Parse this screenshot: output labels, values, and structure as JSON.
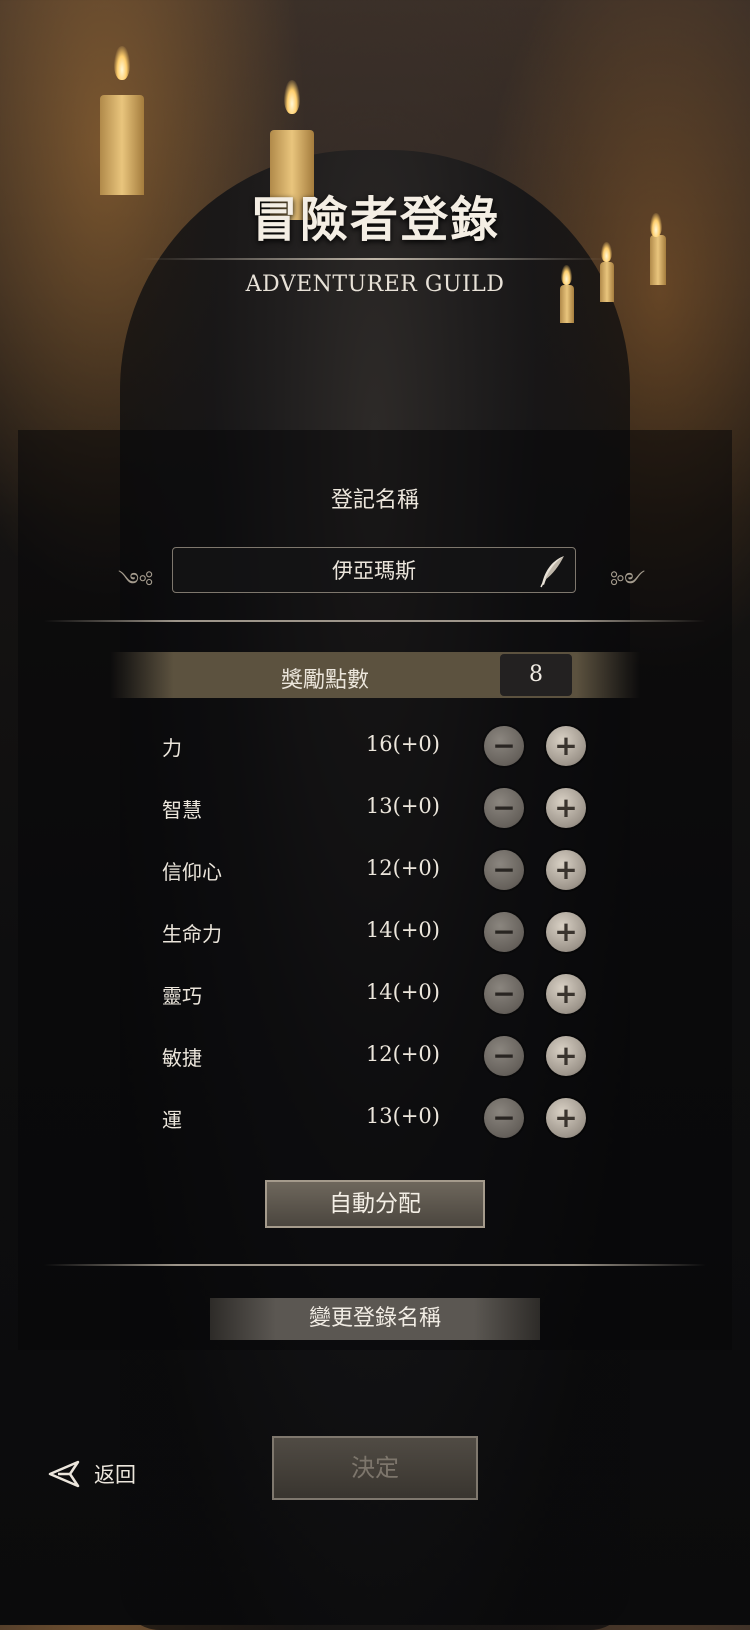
{
  "header": {
    "title": "冒險者登錄",
    "subtitle": "ADVENTURER GUILD"
  },
  "registration": {
    "section_label": "登記名稱",
    "name_value": "伊亞瑪斯"
  },
  "bonus": {
    "label": "獎勵點數",
    "value": "8"
  },
  "stats": [
    {
      "name": "力",
      "value": "16(+0)"
    },
    {
      "name": "智慧",
      "value": "13(+0)"
    },
    {
      "name": "信仰心",
      "value": "12(+0)"
    },
    {
      "name": "生命力",
      "value": "14(+0)"
    },
    {
      "name": "靈巧",
      "value": "14(+0)"
    },
    {
      "name": "敏捷",
      "value": "12(+0)"
    },
    {
      "name": "運",
      "value": "13(+0)"
    }
  ],
  "buttons": {
    "auto_assign": "自動分配",
    "change_name": "變更登錄名稱",
    "confirm": "決定",
    "back": "返回",
    "minus": "−",
    "plus": "+"
  },
  "icons": {
    "edit": "quill-icon",
    "back": "back-arrow-icon",
    "ornament": "scroll-ornament-icon"
  },
  "colors": {
    "panel_bar": "#5c523f",
    "button_face": "#9d958b",
    "text": "#ece6dc"
  }
}
